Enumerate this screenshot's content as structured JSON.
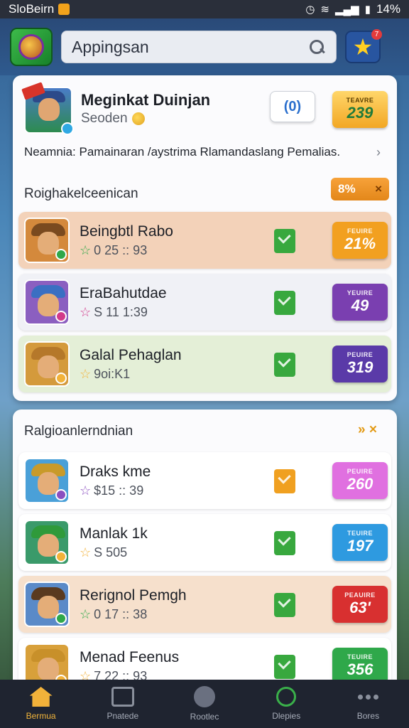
{
  "status_bar": {
    "carrier": "SloBeirn",
    "right_text": "14%"
  },
  "header": {
    "search_text": "Appingsan",
    "badge_count": "7"
  },
  "featured": {
    "title": "Meginkat Duinjan",
    "subtitle": "Seoden",
    "chip_label": "(0)",
    "price_small": "TEAVRE",
    "price_value": "239",
    "description": "Neamnia: Pamainaran /aystrima Rlamandaslang Pemalias.",
    "section_label": "Roighakelceenican",
    "tag_value": "8%"
  },
  "section1_rows": [
    {
      "title": "Beingbtl Rabo",
      "meta": "0 25 :: 93",
      "price_small": "FEUIRE",
      "price_value": "21%",
      "bg": "#f3d2b9",
      "price_color": "#f2a020",
      "dl_color": "#38a83e",
      "hat": "#7a4a1f",
      "badge": "#2fa84a",
      "avatar_bg": "#d4893c"
    },
    {
      "title": "EraBahutdae",
      "meta": "S 11 1:39",
      "price_small": "YEUIRE",
      "price_value": "49",
      "bg": "#f0f1f6",
      "price_color": "#7a3fb0",
      "dl_color": "#38a83e",
      "hat": "#3a6fc2",
      "badge": "#d23a8a",
      "avatar_bg": "#8b5fc0"
    },
    {
      "title": "Galal Pehaglan",
      "meta": "9oi:K1",
      "price_small": "PEUIRE",
      "price_value": "319",
      "bg": "#e4efd7",
      "price_color": "#5a3aa8",
      "dl_color": "#38a83e",
      "hat": "#b5782a",
      "badge": "#f2b23a",
      "avatar_bg": "#d49a3c"
    }
  ],
  "section2": {
    "label": "Ralgioanlerndnian",
    "action": "» ×"
  },
  "section2_rows": [
    {
      "title": "Draks kme",
      "meta": "$15 :: 39",
      "price_small": "PEUIRE",
      "price_value": "260",
      "bg": "#ffffff",
      "price_color": "#e070e0",
      "dl_color": "#f0a020",
      "hat": "#c89a2a",
      "badge": "#8a4fc0",
      "avatar_bg": "#4aa0d8"
    },
    {
      "title": "Manlak 1k",
      "meta": "S 505",
      "price_small": "TEUIRE",
      "price_value": "197",
      "bg": "#ffffff",
      "price_color": "#2e9ae0",
      "dl_color": "#38a83e",
      "hat": "#2f9a3a",
      "badge": "#f2b23a",
      "avatar_bg": "#3a9a6a"
    },
    {
      "title": "Rerignol Pemgh",
      "meta": "0 17 :: 38",
      "price_small": "PEAUIRE",
      "price_value": "63'",
      "bg": "#f6e0cc",
      "price_color": "#d83030",
      "dl_color": "#38a83e",
      "hat": "#5a3a1f",
      "badge": "#2fa84a",
      "avatar_bg": "#5a8ac8"
    },
    {
      "title": "Menad Feenus",
      "meta": "7 22 :: 93",
      "price_small": "TEUIRE",
      "price_value": "356",
      "bg": "#ffffff",
      "price_color": "#2fa84a",
      "dl_color": "#38a83e",
      "hat": "#c8902a",
      "badge": "#f2b23a",
      "avatar_bg": "#d8a03a"
    }
  ],
  "bottom_nav": [
    {
      "label": "Bermua",
      "icon": "home-icon",
      "active": true
    },
    {
      "label": "Pnatede",
      "icon": "lock-icon",
      "active": false
    },
    {
      "label": "Rootlec",
      "icon": "arrow-icon",
      "active": false
    },
    {
      "label": "Dlepies",
      "icon": "power-icon",
      "active": false
    },
    {
      "label": "Bores",
      "icon": "more-icon",
      "active": false
    }
  ],
  "colors": {
    "accent": "#f2b23a",
    "header": "#2a4a78"
  }
}
